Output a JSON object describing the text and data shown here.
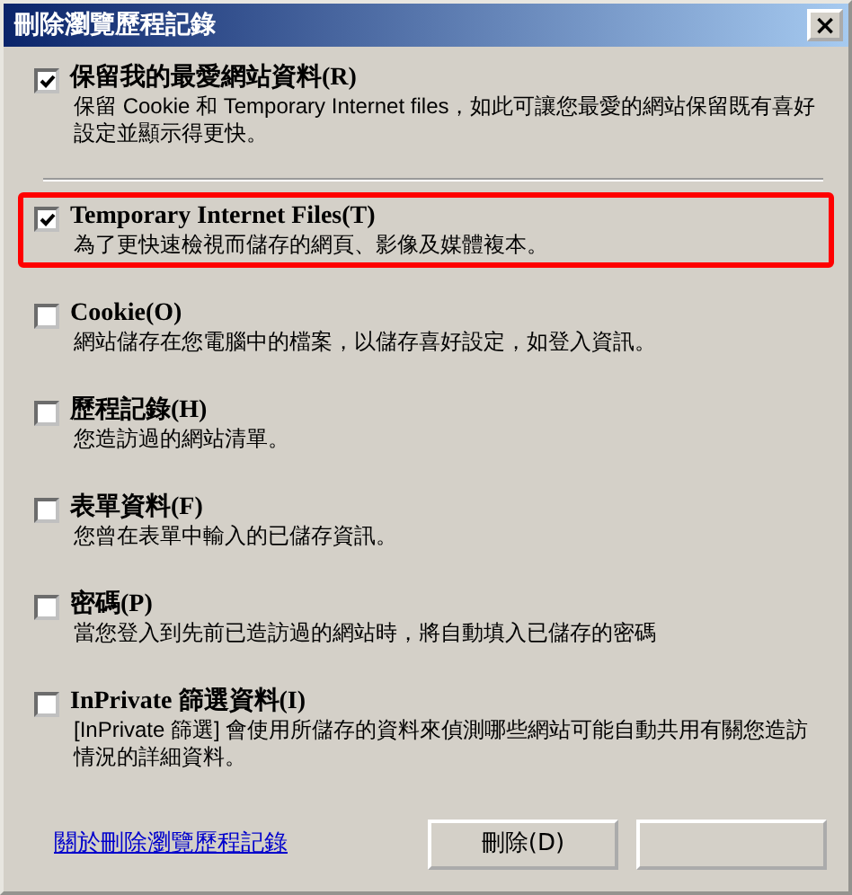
{
  "window": {
    "title": "刪除瀏覽歷程記錄",
    "close": "×"
  },
  "options": [
    {
      "label": "保留我的最愛網站資料(R)",
      "description": "保留 Cookie 和 Temporary Internet files，如此可讓您最愛的網站保留既有喜好設定並顯示得更快。",
      "checked": true,
      "highlighted": false,
      "divider_after": true
    },
    {
      "label": "Temporary Internet Files(T)",
      "description": "為了更快速檢視而儲存的網頁、影像及媒體複本。",
      "checked": true,
      "highlighted": true,
      "divider_after": false
    },
    {
      "label": "Cookie(O)",
      "description": "網站儲存在您電腦中的檔案，以儲存喜好設定，如登入資訊。",
      "checked": false,
      "highlighted": false,
      "divider_after": false
    },
    {
      "label": "歷程記錄(H)",
      "description": "您造訪過的網站清單。",
      "checked": false,
      "highlighted": false,
      "divider_after": false
    },
    {
      "label": "表單資料(F)",
      "description": "您曾在表單中輸入的已儲存資訊。",
      "checked": false,
      "highlighted": false,
      "divider_after": false
    },
    {
      "label": "密碼(P)",
      "description": "當您登入到先前已造訪過的網站時，將自動填入已儲存的密碼",
      "checked": false,
      "highlighted": false,
      "divider_after": false
    },
    {
      "label": "InPrivate 篩選資料(I)",
      "description": "[InPrivate 篩選] 會使用所儲存的資料來偵測哪些網站可能自動共用有關您造訪情況的詳細資料。",
      "checked": false,
      "highlighted": false,
      "divider_after": false
    }
  ],
  "footer": {
    "link": "關於刪除瀏覽歷程記錄",
    "buttons": [
      {
        "kind": "labeled",
        "label": "刪除(D)"
      },
      {
        "kind": "blank"
      }
    ]
  }
}
